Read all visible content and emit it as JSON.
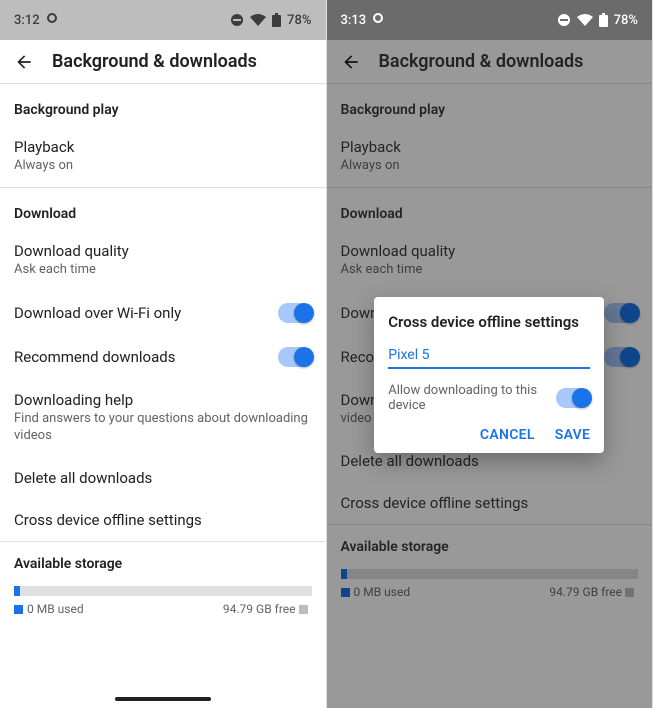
{
  "left": {
    "status": {
      "time": "3:12",
      "battery": "78%"
    },
    "title": "Background & downloads",
    "bg_play_header": "Background play",
    "playback": {
      "title": "Playback",
      "sub": "Always on"
    },
    "download_header": "Download",
    "quality": {
      "title": "Download quality",
      "sub": "Ask each time"
    },
    "wifi": {
      "title": "Download over Wi-Fi only"
    },
    "recommend": {
      "title": "Recommend downloads"
    },
    "help": {
      "title": "Downloading help",
      "sub": "Find answers to your questions about downloading videos"
    },
    "delete": {
      "title": "Delete all downloads"
    },
    "cross": {
      "title": "Cross device offline settings"
    },
    "storage": {
      "header": "Available storage",
      "used": "0 MB used",
      "free": "94.79 GB free"
    }
  },
  "right": {
    "status": {
      "time": "3:13",
      "battery": "78%"
    },
    "title": "Background & downloads",
    "bg_play_header": "Background play",
    "playback": {
      "title": "Playback",
      "sub": "Always on"
    },
    "download_header": "Download",
    "quality": {
      "title": "Download quality",
      "sub": "Ask each time"
    },
    "wifi": {
      "title": "Down"
    },
    "recommend": {
      "title": "Reco"
    },
    "help": {
      "title": "Down",
      "sub": "video"
    },
    "delete": {
      "title": "Delete all downloads"
    },
    "cross": {
      "title": "Cross device offline settings"
    },
    "storage": {
      "header": "Available storage",
      "used": "0 MB used",
      "free": "94.79 GB free"
    },
    "dialog": {
      "title": "Cross device offline settings",
      "device": "Pixel 5",
      "allow": "Allow downloading to this device",
      "cancel": "CANCEL",
      "save": "SAVE"
    }
  }
}
